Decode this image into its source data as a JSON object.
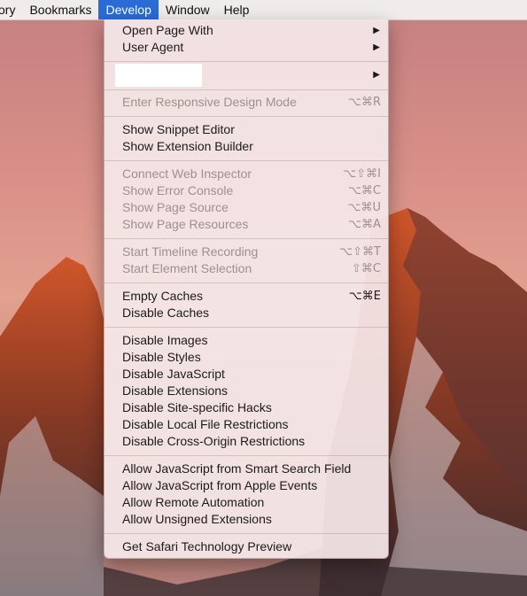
{
  "menubar": {
    "items": [
      "ory",
      "Bookmarks",
      "Develop",
      "Window",
      "Help"
    ],
    "active_index": 2
  },
  "menu": {
    "open_page_with": "Open Page With",
    "user_agent": "User Agent",
    "submenu_arrow": "▶",
    "responsive": {
      "label": "Enter Responsive Design Mode",
      "shortcut": "⌥⌘R"
    },
    "snippet_editor": "Show Snippet Editor",
    "extension_builder": "Show Extension Builder",
    "web_inspector": {
      "label": "Connect Web Inspector",
      "shortcut": "⌥⇧⌘I"
    },
    "error_console": {
      "label": "Show Error Console",
      "shortcut": "⌥⌘C"
    },
    "page_source": {
      "label": "Show Page Source",
      "shortcut": "⌥⌘U"
    },
    "page_resources": {
      "label": "Show Page Resources",
      "shortcut": "⌥⌘A"
    },
    "timeline": {
      "label": "Start Timeline Recording",
      "shortcut": "⌥⇧⌘T"
    },
    "element_selection": {
      "label": "Start Element Selection",
      "shortcut": "⇧⌘C"
    },
    "empty_caches": {
      "label": "Empty Caches",
      "shortcut": "⌥⌘E"
    },
    "disable_caches": "Disable Caches",
    "disable_images": "Disable Images",
    "disable_styles": "Disable Styles",
    "disable_javascript": "Disable JavaScript",
    "disable_extensions": "Disable Extensions",
    "disable_site_hacks": "Disable Site-specific Hacks",
    "disable_local_file": "Disable Local File Restrictions",
    "disable_cross_origin": "Disable Cross-Origin Restrictions",
    "allow_js_smart_search": "Allow JavaScript from Smart Search Field",
    "allow_js_apple_events": "Allow JavaScript from Apple Events",
    "allow_remote_automation": "Allow Remote Automation",
    "allow_unsigned_extensions": "Allow Unsigned Extensions",
    "get_tech_preview": "Get Safari Technology Preview"
  }
}
